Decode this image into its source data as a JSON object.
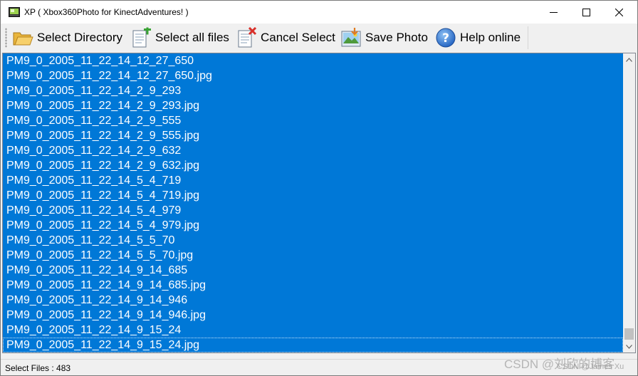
{
  "window": {
    "title": "XP ( Xbox360Photo for KinectAdventures! )"
  },
  "toolbar": {
    "items": [
      {
        "label": "Select Directory",
        "icon": "folder-open-icon"
      },
      {
        "label": "Select all files",
        "icon": "document-add-icon"
      },
      {
        "label": "Cancel Select",
        "icon": "document-cancel-icon"
      },
      {
        "label": "Save Photo",
        "icon": "save-photo-icon"
      },
      {
        "label": "Help online",
        "icon": "help-icon"
      }
    ]
  },
  "file_list": {
    "selected_all": true,
    "selection_color": "#0078d7",
    "items": [
      "PM9_0_2005_11_22_14_12_27_650",
      "PM9_0_2005_11_22_14_12_27_650.jpg",
      "PM9_0_2005_11_22_14_2_9_293",
      "PM9_0_2005_11_22_14_2_9_293.jpg",
      "PM9_0_2005_11_22_14_2_9_555",
      "PM9_0_2005_11_22_14_2_9_555.jpg",
      "PM9_0_2005_11_22_14_2_9_632",
      "PM9_0_2005_11_22_14_2_9_632.jpg",
      "PM9_0_2005_11_22_14_5_4_719",
      "PM9_0_2005_11_22_14_5_4_719.jpg",
      "PM9_0_2005_11_22_14_5_4_979",
      "PM9_0_2005_11_22_14_5_4_979.jpg",
      "PM9_0_2005_11_22_14_5_5_70",
      "PM9_0_2005_11_22_14_5_5_70.jpg",
      "PM9_0_2005_11_22_14_9_14_685",
      "PM9_0_2005_11_22_14_9_14_685.jpg",
      "PM9_0_2005_11_22_14_9_14_946",
      "PM9_0_2005_11_22_14_9_14_946.jpg",
      "PM9_0_2005_11_22_14_9_15_24",
      "PM9_0_2005_11_22_14_9_15_24.jpg"
    ]
  },
  "status": {
    "text": "Select Files : 483"
  },
  "watermark": {
    "text": "CSDN @刘欣的博客",
    "text2": "CSDN @James Xu"
  }
}
